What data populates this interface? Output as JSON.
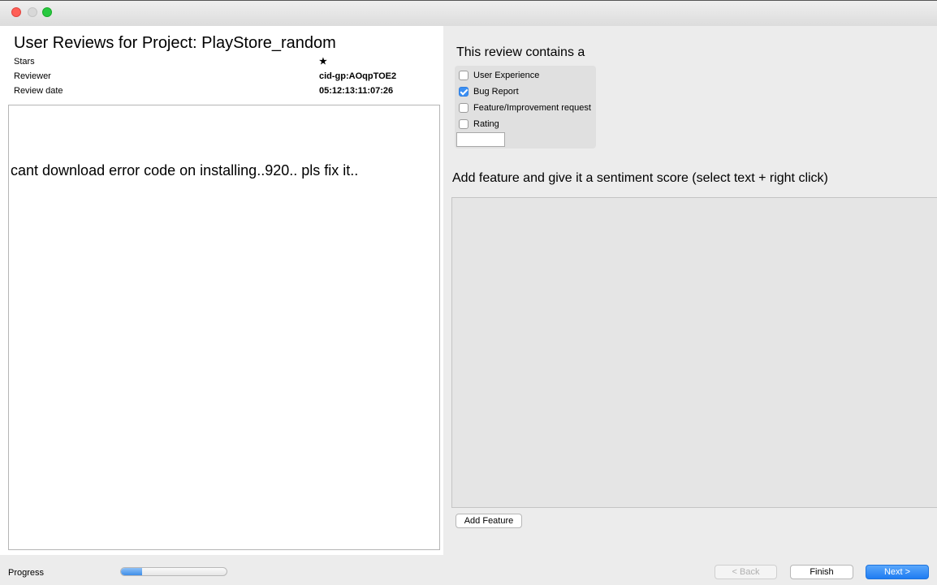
{
  "window": {
    "title": ""
  },
  "header": {
    "title": "User Reviews for Project: PlayStore_random",
    "fields": [
      {
        "label": "Stars",
        "value": "★"
      },
      {
        "label": "Reviewer",
        "value": "cid-gp:AOqpTOE2"
      },
      {
        "label": "Review date",
        "value": "05:12:13:11:07:26"
      }
    ]
  },
  "review": {
    "text": "cant download  error code on installing..920.. pls fix it.."
  },
  "classification": {
    "title": "This review contains a",
    "options": [
      {
        "label": "User Experience",
        "checked": false
      },
      {
        "label": "Bug Report",
        "checked": true
      },
      {
        "label": "Feature/Improvement request",
        "checked": false
      },
      {
        "label": "Rating",
        "checked": false
      }
    ],
    "rating_value": ""
  },
  "features": {
    "title": "Add feature and give it a sentiment score (select text + right click)",
    "add_button": "Add Feature"
  },
  "footer": {
    "progress_label": "Progress",
    "progress_fraction": 0.2,
    "back_label": "< Back",
    "finish_label": "Finish",
    "next_label": "Next >"
  },
  "colors": {
    "accent": "#3b8ff3",
    "next_button": "#1f7cf2"
  }
}
